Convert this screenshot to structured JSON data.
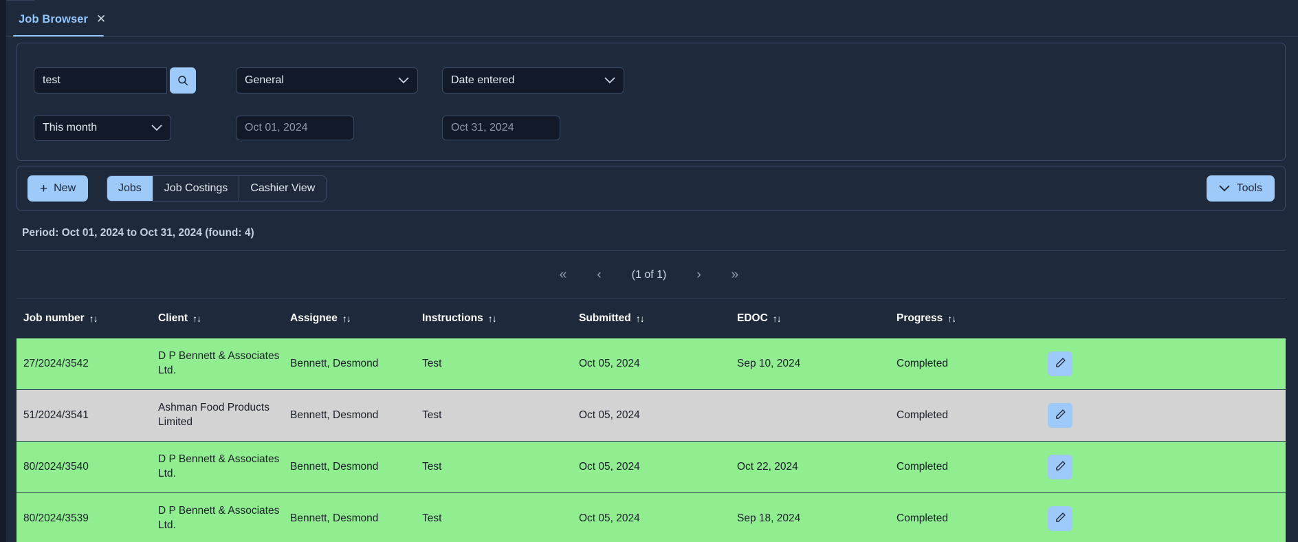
{
  "tab": {
    "label": "Job Browser",
    "close_icon": "close-icon",
    "close_glyph": "✕"
  },
  "filters": {
    "search": {
      "value": "test",
      "placeholder": "",
      "button_icon": "search-icon"
    },
    "category": {
      "value": "General",
      "icon": "chevron-down-icon"
    },
    "date_type": {
      "value": "Date entered",
      "icon": "chevron-down-icon"
    },
    "period": {
      "value": "This month",
      "icon": "chevron-down-icon"
    },
    "date_from": {
      "value": "",
      "placeholder": "Oct 01, 2024"
    },
    "date_to": {
      "value": "",
      "placeholder": "Oct 31, 2024"
    }
  },
  "actions": {
    "new_label": "New",
    "new_icon": "plus-icon",
    "tabs": [
      {
        "label": "Jobs",
        "active": true
      },
      {
        "label": "Job Costings",
        "active": false
      },
      {
        "label": "Cashier View",
        "active": false
      }
    ],
    "tools_label": "Tools",
    "tools_icon": "chevron-down-icon"
  },
  "period_text": "Period: Oct 01, 2024 to Oct 31, 2024 (found: 4)",
  "pagination": {
    "first": "«",
    "prev": "‹",
    "label": "(1 of 1)",
    "next": "›",
    "last": "»"
  },
  "table": {
    "sort_glyph": "↑↓",
    "columns": [
      "Job number",
      "Client",
      "Assignee",
      "Instructions",
      "Submitted",
      "EDOC",
      "Progress"
    ],
    "rows": [
      {
        "job_number": "27/2024/3542",
        "client": "D P Bennett & Associates Ltd.",
        "assignee": "Bennett, Desmond",
        "instructions": "Test",
        "submitted": "Oct 05, 2024",
        "edoc": "Sep 10, 2024",
        "progress": "Completed",
        "highlight": "green"
      },
      {
        "job_number": "51/2024/3541",
        "client": "Ashman Food Products Limited",
        "assignee": "Bennett, Desmond",
        "instructions": "Test",
        "submitted": "Oct 05, 2024",
        "edoc": "",
        "progress": "Completed",
        "highlight": "grey"
      },
      {
        "job_number": "80/2024/3540",
        "client": "D P Bennett & Associates Ltd.",
        "assignee": "Bennett, Desmond",
        "instructions": "Test",
        "submitted": "Oct 05, 2024",
        "edoc": "Oct 22, 2024",
        "progress": "Completed",
        "highlight": "green"
      },
      {
        "job_number": "80/2024/3539",
        "client": "D P Bennett & Associates Ltd.",
        "assignee": "Bennett, Desmond",
        "instructions": "Test",
        "submitted": "Oct 05, 2024",
        "edoc": "Sep 18, 2024",
        "progress": "Completed",
        "highlight": "green"
      }
    ],
    "row_action_icon": "edit-pencil-icon"
  },
  "colors": {
    "accent": "#9dcaf8",
    "panel_bg": "#1e293b",
    "field_bg": "#121a29",
    "row_green": "#90ee90",
    "row_grey": "#d3d3d3"
  }
}
